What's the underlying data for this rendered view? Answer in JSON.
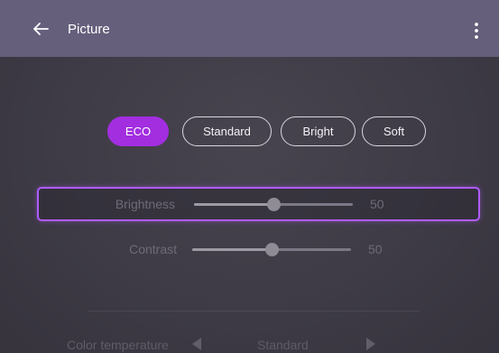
{
  "header": {
    "title": "Picture",
    "back_icon": "arrow-left-icon",
    "menu_icon": "more-vertical-icon"
  },
  "modes": {
    "selected": "ECO",
    "items": [
      {
        "label": "ECO",
        "active": true
      },
      {
        "label": "Standard",
        "active": false
      },
      {
        "label": "Bright",
        "active": false
      },
      {
        "label": "Soft",
        "active": false
      }
    ]
  },
  "settings": {
    "brightness": {
      "label": "Brightness",
      "value": "50",
      "level": 0.5,
      "focused": true
    },
    "contrast": {
      "label": "Contrast",
      "value": "50",
      "level": 0.5,
      "focused": false
    },
    "color_temperature": {
      "label": "Color temperature",
      "value": "Standard"
    }
  },
  "colors": {
    "header_bg": "#655f7c",
    "background": "#3d3a45",
    "accent": "#a22ee0",
    "focus_border": "#b05cff"
  }
}
